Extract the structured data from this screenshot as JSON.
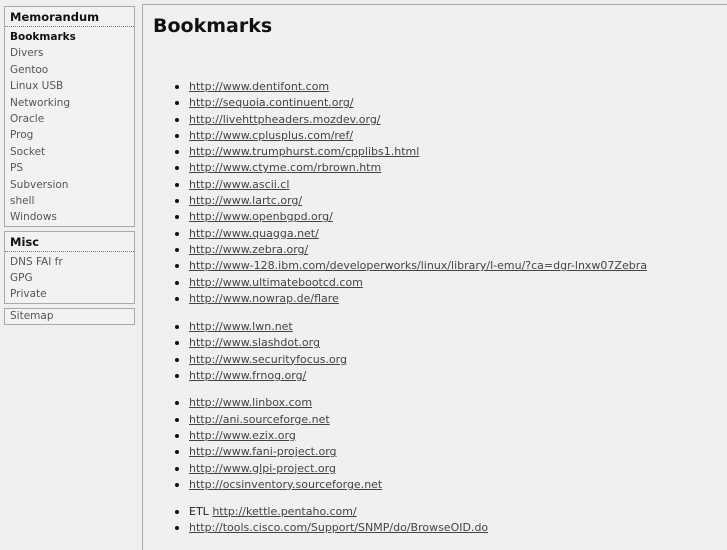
{
  "sidebar": {
    "memorandum": {
      "title": "Memorandum",
      "items": [
        "Bookmarks",
        "Divers",
        "Gentoo",
        "Linux USB",
        "Networking",
        "Oracle",
        "Prog",
        "Socket",
        "PS",
        "Subversion",
        "shell",
        "Windows"
      ]
    },
    "misc": {
      "title": "Misc",
      "items": [
        "DNS FAI fr",
        "GPG",
        "Private"
      ]
    },
    "sitemap": "Sitemap"
  },
  "main": {
    "title": "Bookmarks",
    "group1": [
      "http://www.dentifont.com",
      "http://sequoia.continuent.org/",
      "http://livehttpheaders.mozdev.org/",
      "http://www.cplusplus.com/ref/",
      "http://www.trumphurst.com/cpplibs1.html",
      "http://www.ctyme.com/rbrown.htm",
      "http://www.ascii.cl",
      "http://www.lartc.org/",
      "http://www.openbgpd.org/",
      "http://www.quagga.net/",
      "http://www.zebra.org/",
      "http://www-128.ibm.com/developerworks/linux/library/l-emu/?ca=dgr-lnxw07Zebra",
      "http://www.ultimatebootcd.com",
      "http://www.nowrap.de/flare"
    ],
    "group2": [
      "http://www.lwn.net",
      "http://www.slashdot.org",
      "http://www.securityfocus.org",
      "http://www.frnog.org/"
    ],
    "group3": [
      "http://www.linbox.com",
      "http://ani.sourceforge.net",
      "http://www.ezix.org",
      "http://www.fani-project.org",
      "http://www.glpi-project.org",
      "http://ocsinventory.sourceforge.net"
    ],
    "group4": {
      "etl_prefix": "ETL",
      "etl_link": "http://kettle.pentaho.com/",
      "cisco_link": "http://tools.cisco.com/Support/SNMP/do/BrowseOID.do"
    }
  }
}
